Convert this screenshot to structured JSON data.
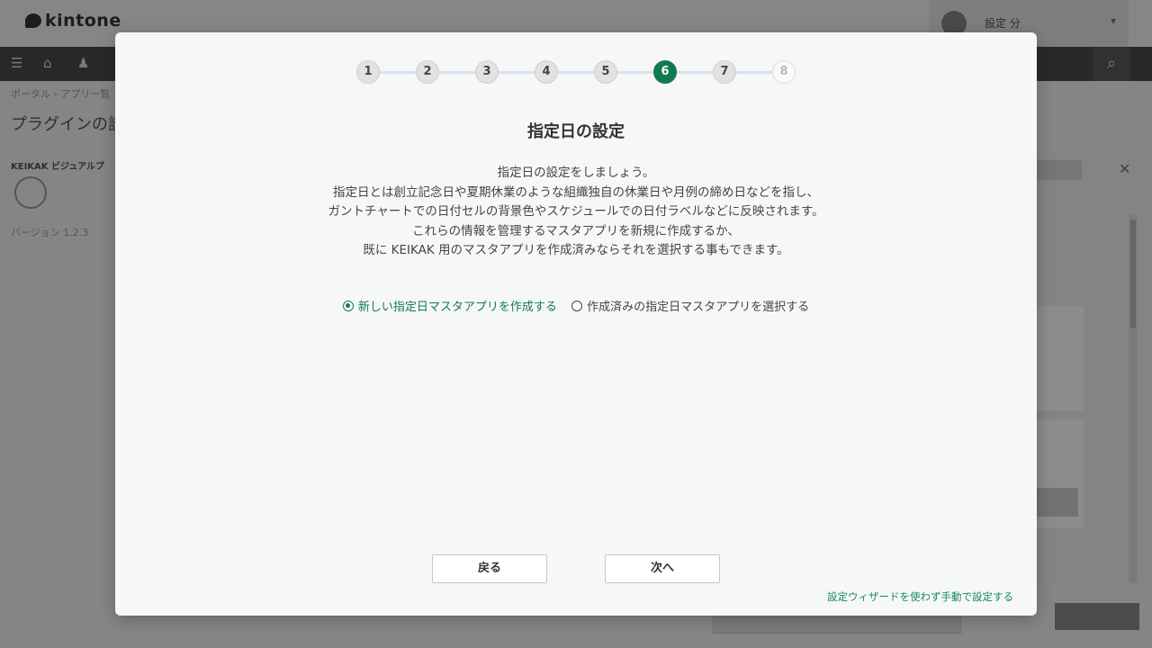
{
  "background": {
    "logo": "kintone",
    "user_name": "設定 分",
    "breadcrumb": "ポータル › アプリ一覧",
    "page_title": "プラグインの設定",
    "plugin_label": "KEIKAK ビジュアルプ",
    "plugin_sub": "バージョン 1.2.3"
  },
  "wizard": {
    "steps": [
      "1",
      "2",
      "3",
      "4",
      "5",
      "6",
      "7",
      "8"
    ],
    "current_step": 6,
    "title": "指定日の設定",
    "description": [
      "指定日の設定をしましょう。",
      "指定日とは創立記念日や夏期休業のような組織独自の休業日や月例の締め日などを指し、",
      "ガントチャートでの日付セルの背景色やスケジュールでの日付ラベルなどに反映されます。",
      "これらの情報を管理するマスタアプリを新規に作成するか、",
      "既に KEIKAK 用のマスタアプリを作成済みならそれを選択する事もできます。"
    ],
    "options": {
      "create_new": "新しい指定日マスタアプリを作成する",
      "select_existing": "作成済みの指定日マスタアプリを選択する",
      "selected": "create_new"
    },
    "back_label": "戻る",
    "next_label": "次へ",
    "manual_link": "設定ウィザードを使わず手動で設定する"
  },
  "colors": {
    "accent": "#127a52",
    "link": "#1a8a5c",
    "step_line": "#dcdff0"
  }
}
